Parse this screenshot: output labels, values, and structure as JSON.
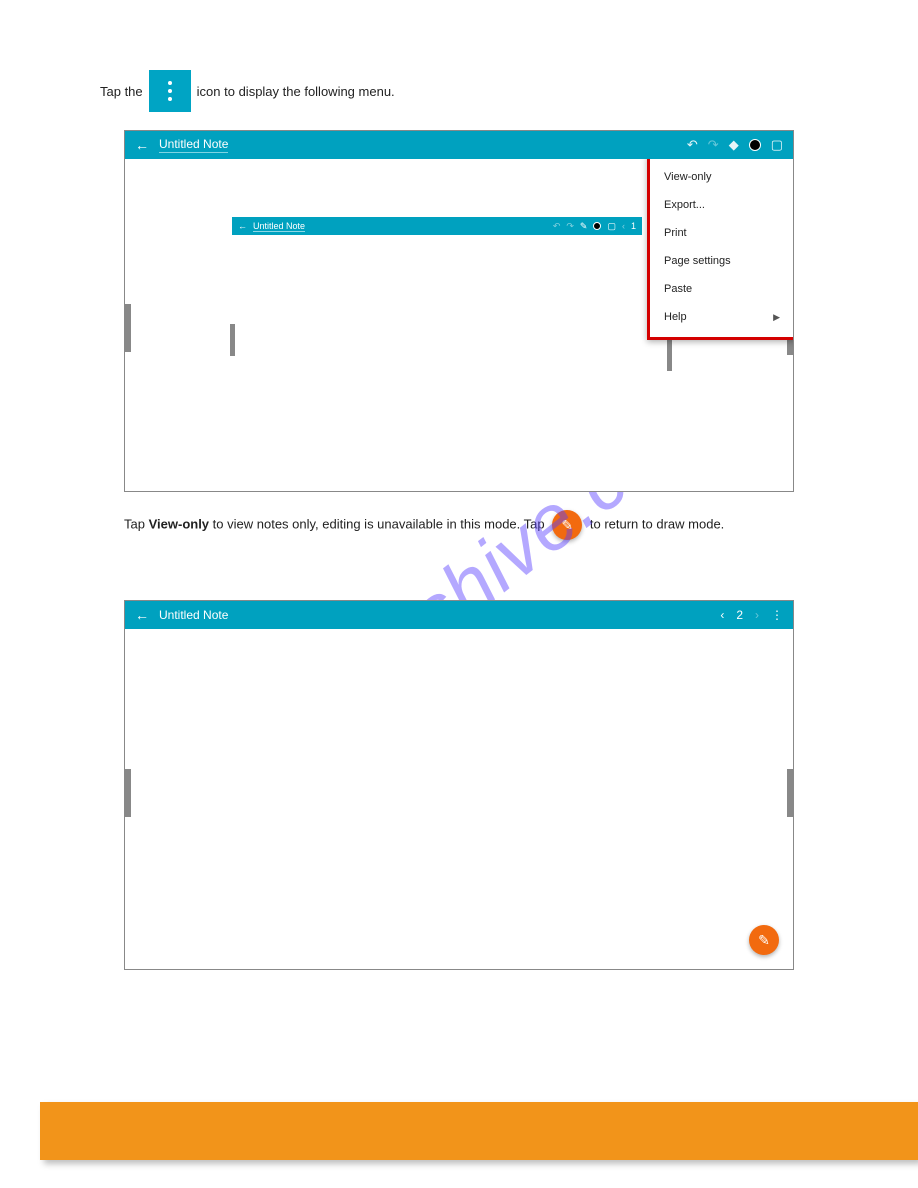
{
  "intro": {
    "prefix": "Tap the",
    "suffix": "icon to display the following menu."
  },
  "watermark": "manualshive.com",
  "dropdown": {
    "items": [
      "View-only",
      "Export...",
      "Print",
      "Page settings",
      "Paste",
      "Help"
    ]
  },
  "note1": {
    "title": "Untitled Note"
  },
  "inner": {
    "title": "Untitled Note",
    "page": "1"
  },
  "note2": {
    "title": "Untitled Note",
    "page": "2"
  },
  "caption": {
    "seg1": "Tap",
    "seg2": "View-only",
    "seg3": "to view notes only, editing is unavailable in this mode. Tap",
    "seg4": "to return to",
    "seg5": "draw mode."
  }
}
